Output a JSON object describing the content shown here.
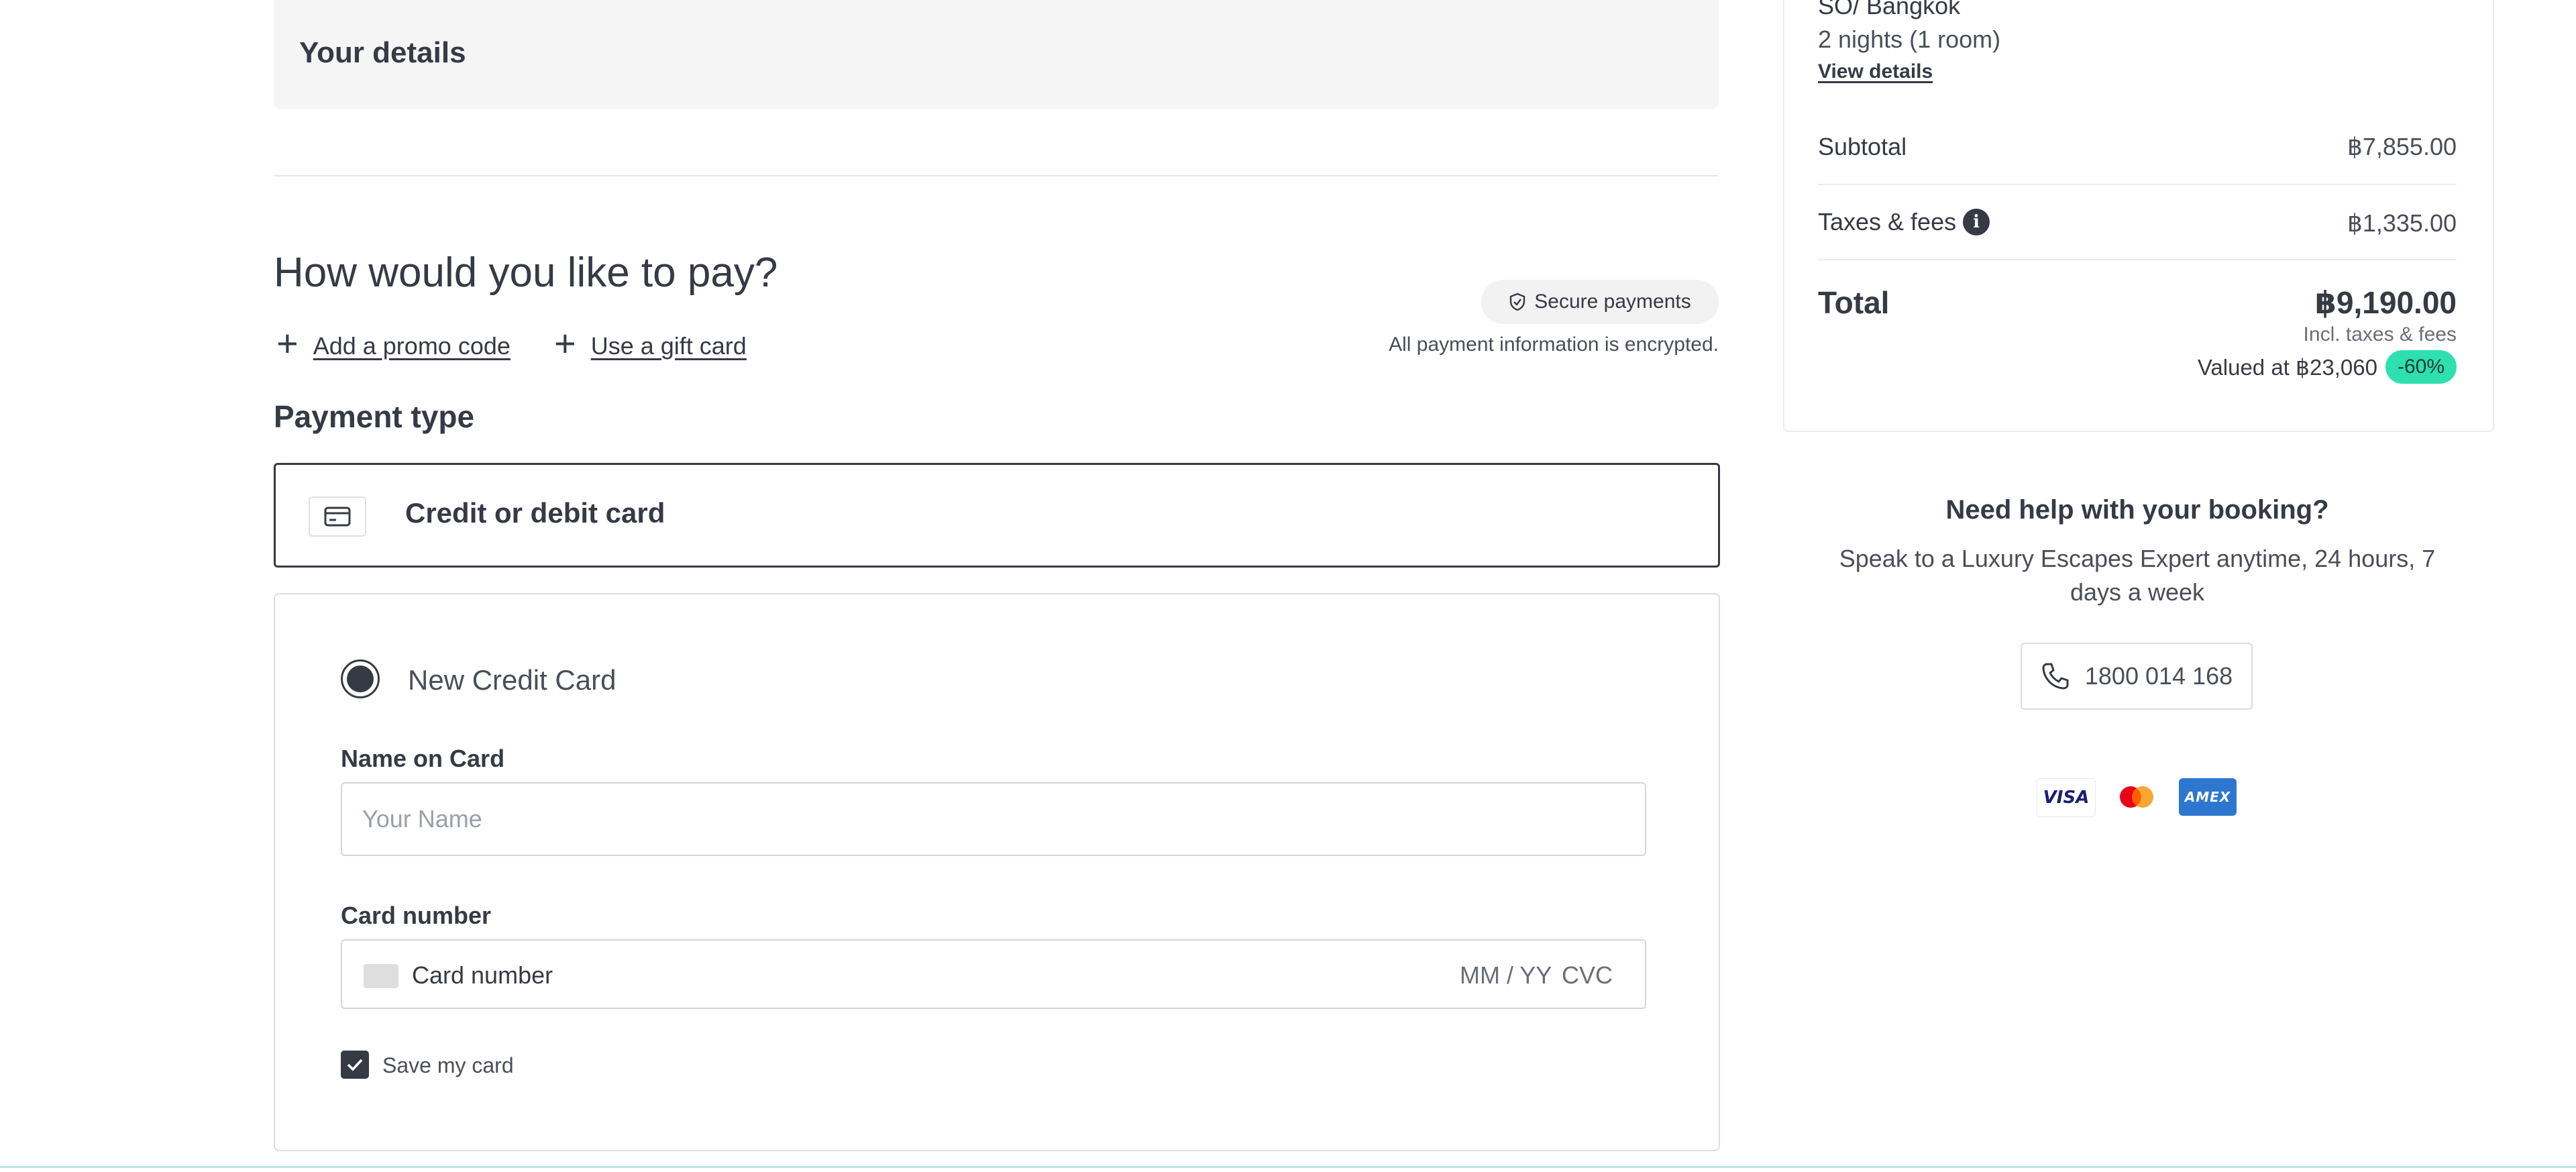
{
  "details": {
    "title": "Your details"
  },
  "payment": {
    "title": "How would you like to pay?",
    "promo_link": "Add a promo code",
    "gift_link": "Use a gift card",
    "secure_badge": "Secure payments",
    "encrypted_note": "All payment information is encrypted.",
    "type_heading": "Payment type",
    "type_option": "Credit or debit card"
  },
  "card_form": {
    "radio_label": "New Credit Card",
    "name_label": "Name on Card",
    "name_placeholder": "Your Name",
    "number_label": "Card number",
    "number_placeholder": "Card number",
    "expiry_placeholder": "MM / YY",
    "cvc_placeholder": "CVC",
    "save_card_label": "Save my card",
    "save_card_checked": true
  },
  "summary": {
    "property": "SO/ Bangkok",
    "stay": "2 nights (1 room)",
    "view_details": "View details",
    "subtotal_label": "Subtotal",
    "subtotal_value": "฿7,855.00",
    "taxes_label": "Taxes & fees",
    "taxes_value": "฿1,335.00",
    "total_label": "Total",
    "total_value": "฿9,190.00",
    "incl_note": "Incl. taxes & fees",
    "valued_at": "Valued at ฿23,060",
    "discount": "-60%"
  },
  "help": {
    "title": "Need help with your booking?",
    "subtitle": "Speak to a Luxury Escapes Expert anytime, 24 hours, 7 days a week",
    "phone": "1800 014 168"
  },
  "payment_logos": {
    "visa": "VISA",
    "mastercard_icon": "mastercard-icon",
    "amex": "AMEX"
  },
  "colors": {
    "text": "#363a45",
    "discount_badge": "#2ee0b0",
    "amex_blue": "#2e77d0",
    "visa_navy": "#1a1f71"
  }
}
